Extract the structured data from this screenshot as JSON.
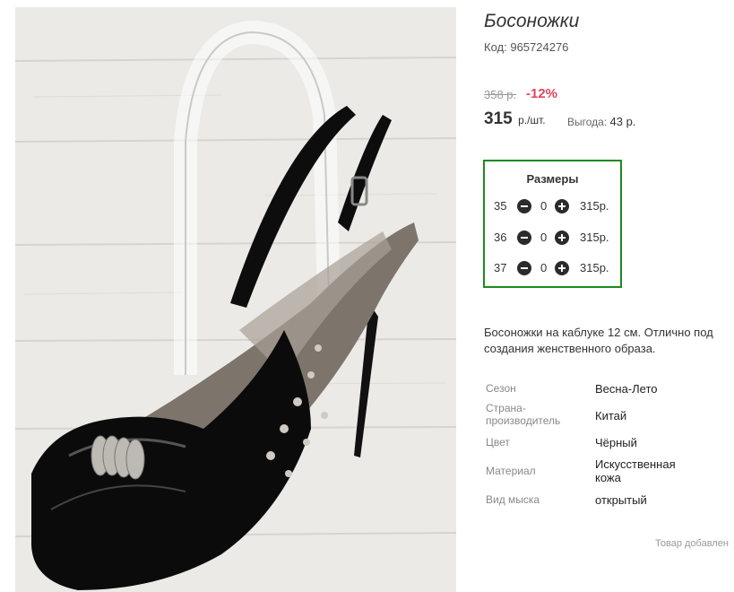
{
  "product": {
    "title": "Босоножки",
    "code_label": "Код:",
    "code": "965724276",
    "old_price": "358 р.",
    "discount": "-12%",
    "price": "315",
    "price_unit": "р./шт.",
    "benefit_label": "Выгода:",
    "benefit_value": "43 р."
  },
  "sizes": {
    "title": "Размеры",
    "items": [
      {
        "size": "35",
        "qty": "0",
        "price": "315р."
      },
      {
        "size": "36",
        "qty": "0",
        "price": "315р."
      },
      {
        "size": "37",
        "qty": "0",
        "price": "315р."
      }
    ]
  },
  "description": "Босоножки на каблуке 12 см. Отлично под создания женственного образа.",
  "specs": [
    {
      "label": "Сезон",
      "value": "Весна-Лето"
    },
    {
      "label": "Страна-производитель",
      "value": "Китай"
    },
    {
      "label": "Цвет",
      "value": "Чёрный"
    },
    {
      "label": "Материал",
      "value": "Искусственная кожа"
    },
    {
      "label": "Вид мыска",
      "value": "открытый"
    }
  ],
  "footer": {
    "added_text": "Товар добавлен"
  },
  "colors": {
    "accent_border": "#1f8a1f",
    "discount": "#e0455c"
  },
  "image": {
    "alt": "black-patent-slingback-sandal"
  }
}
